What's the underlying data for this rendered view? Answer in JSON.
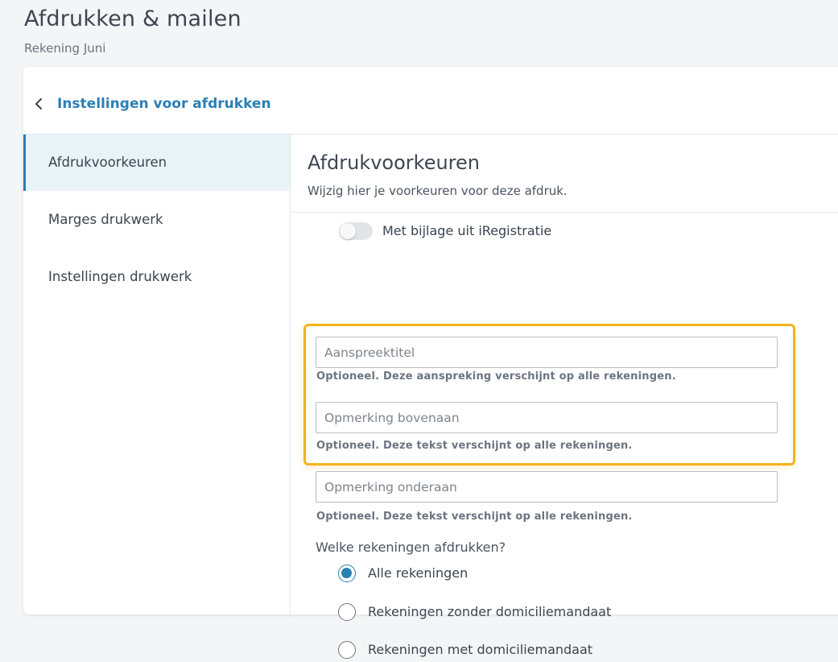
{
  "header": {
    "title": "Afdrukken & mailen",
    "subtitle": "Rekening Juni"
  },
  "card": {
    "back_icon": "chevron-left-icon",
    "title": "Instellingen voor afdrukken"
  },
  "sidebar": {
    "items": [
      {
        "label": "Afdrukvoorkeuren",
        "active": true
      },
      {
        "label": "Marges drukwerk",
        "active": false
      },
      {
        "label": "Instellingen drukwerk",
        "active": false
      }
    ]
  },
  "content": {
    "title": "Afdrukvoorkeuren",
    "subtitle": "Wijzig hier je voorkeuren voor deze afdruk.",
    "toggle": {
      "label": "Met bijlage uit iRegistratie",
      "on": false
    },
    "fields": [
      {
        "placeholder": "Aanspreektitel",
        "value": "",
        "hint": "Optioneel. Deze aanspreking verschijnt op alle rekeningen."
      },
      {
        "placeholder": "Opmerking bovenaan",
        "value": "",
        "hint": "Optioneel. Deze tekst verschijnt op alle rekeningen."
      },
      {
        "placeholder": "Opmerking onderaan",
        "value": "",
        "hint": "Optioneel. Deze tekst verschijnt op alle rekeningen."
      }
    ],
    "question": "Welke rekeningen afdrukken?",
    "radio_options": [
      {
        "label": "Alle rekeningen",
        "checked": true
      },
      {
        "label": "Rekeningen zonder domiciliemandaat",
        "checked": false
      },
      {
        "label": "Rekeningen met domiciliemandaat",
        "checked": false
      }
    ]
  },
  "colors": {
    "accent": "#2a7fb5",
    "highlight": "#f5b21b",
    "active_bg": "#e8f3f8"
  }
}
